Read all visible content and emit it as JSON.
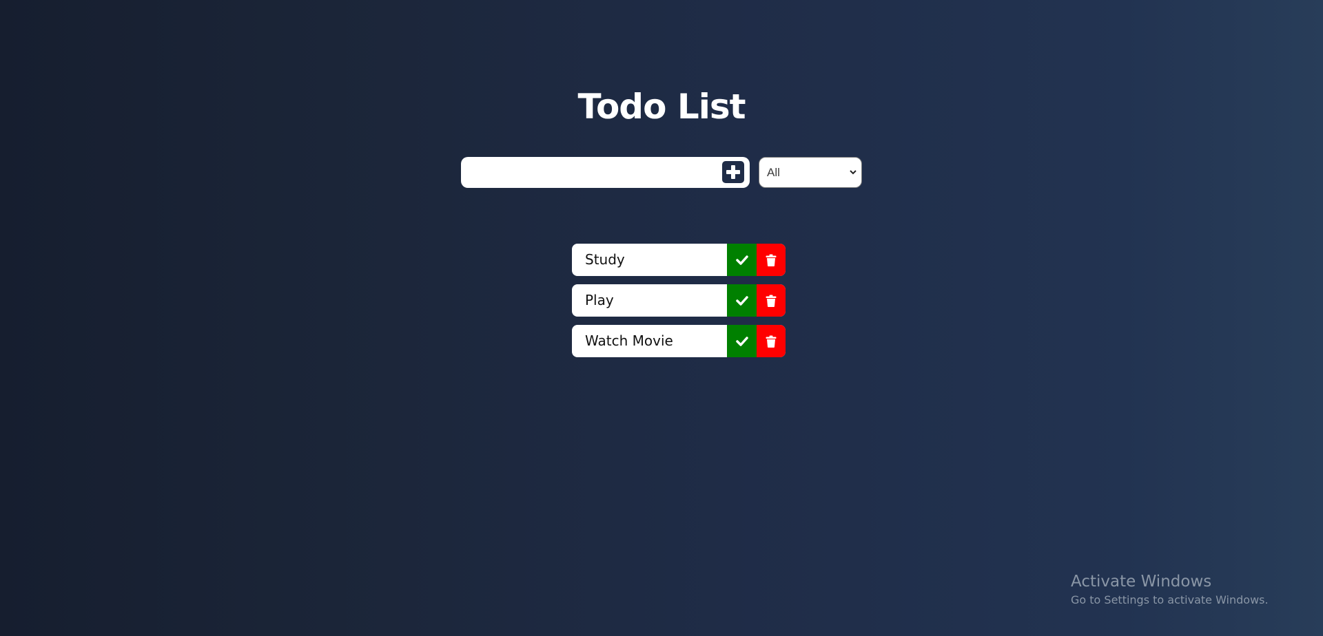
{
  "header": {
    "title": "Todo List"
  },
  "form": {
    "input_value": "",
    "input_placeholder": "",
    "add_icon": "plus-square-icon",
    "filter": {
      "selected": "All"
    }
  },
  "todos": [
    {
      "text": "Study"
    },
    {
      "text": "Play"
    },
    {
      "text": "Watch Movie"
    }
  ],
  "watermark": {
    "title": "Activate Windows",
    "subtitle": "Go to Settings to activate Windows."
  },
  "colors": {
    "complete": "#008000",
    "delete": "#ff0000",
    "accent": "#1f2c47"
  }
}
